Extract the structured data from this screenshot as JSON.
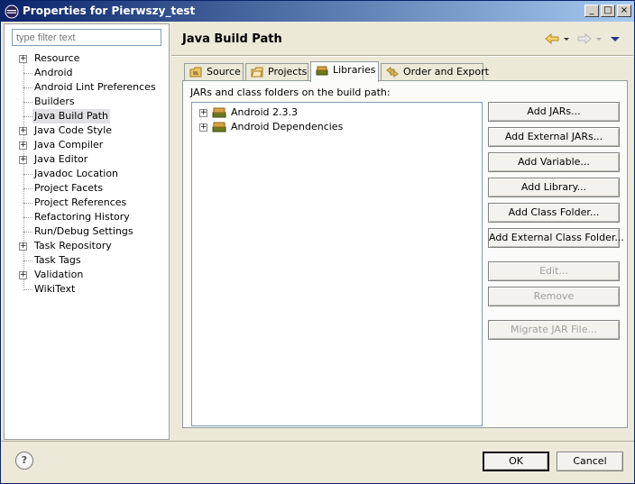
{
  "window": {
    "title": "Properties for Pierwszy_test"
  },
  "titlebar_buttons": {
    "minimize": "_",
    "maximize": "□",
    "close": "×"
  },
  "filter": {
    "placeholder": "type filter text"
  },
  "tree": [
    {
      "label": "Resource",
      "expandable": true
    },
    {
      "label": "Android",
      "expandable": false
    },
    {
      "label": "Android Lint Preferences",
      "expandable": false
    },
    {
      "label": "Builders",
      "expandable": false
    },
    {
      "label": "Java Build Path",
      "expandable": false,
      "selected": true
    },
    {
      "label": "Java Code Style",
      "expandable": true
    },
    {
      "label": "Java Compiler",
      "expandable": true
    },
    {
      "label": "Java Editor",
      "expandable": true
    },
    {
      "label": "Javadoc Location",
      "expandable": false
    },
    {
      "label": "Project Facets",
      "expandable": false
    },
    {
      "label": "Project References",
      "expandable": false
    },
    {
      "label": "Refactoring History",
      "expandable": false
    },
    {
      "label": "Run/Debug Settings",
      "expandable": false
    },
    {
      "label": "Task Repository",
      "expandable": true
    },
    {
      "label": "Task Tags",
      "expandable": false
    },
    {
      "label": "Validation",
      "expandable": true
    },
    {
      "label": "WikiText",
      "expandable": false
    }
  ],
  "page": {
    "title": "Java Build Path"
  },
  "nav_icons": [
    "back-arrow-icon",
    "forward-arrow-icon",
    "view-menu-icon"
  ],
  "tabs": [
    {
      "label": "Source"
    },
    {
      "label": "Projects"
    },
    {
      "label": "Libraries",
      "active": true
    },
    {
      "label": "Order and Export"
    }
  ],
  "libraries": {
    "label": "JARs and class folders on the build path:",
    "items": [
      {
        "label": "Android 2.3.3"
      },
      {
        "label": "Android Dependencies"
      }
    ]
  },
  "buttons": {
    "add_jars": "Add JARs...",
    "add_external_jars": "Add External JARs...",
    "add_variable": "Add Variable...",
    "add_library": "Add Library...",
    "add_class_folder": "Add Class Folder...",
    "add_external_class_folder": "Add External Class Folder...",
    "edit": "Edit...",
    "remove": "Remove",
    "migrate_jar": "Migrate JAR File..."
  },
  "footer": {
    "help": "?",
    "ok": "OK",
    "cancel": "Cancel"
  },
  "colors": {
    "title_bar": "#0a246a",
    "selection": "#e0dfe3",
    "background": "#ece9d8"
  }
}
